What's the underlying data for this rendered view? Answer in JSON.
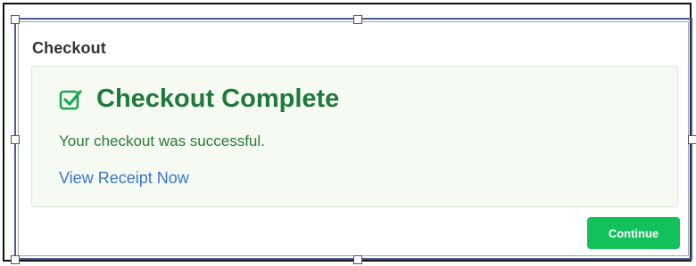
{
  "dialog": {
    "title": "Checkout"
  },
  "success_panel": {
    "icon": "checkbox-checked-icon",
    "heading": "Checkout Complete",
    "message": "Your checkout was successful.",
    "receipt_link": "View Receipt Now"
  },
  "actions": {
    "continue_label": "Continue"
  },
  "colors": {
    "success_green": "#1f7a3a",
    "panel_background": "#f5faf2",
    "link_blue": "#3c77c6",
    "button_green": "#12c15a",
    "selection_frame": "#4a5f8f"
  }
}
